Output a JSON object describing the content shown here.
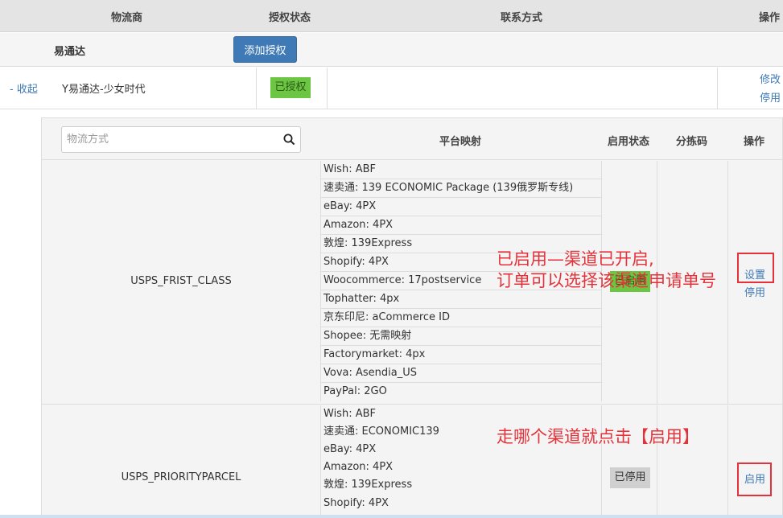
{
  "header": {
    "provider": "物流商",
    "auth_status": "授权状态",
    "contact": "联系方式",
    "operation": "操作"
  },
  "provider": {
    "name": "易通达",
    "add_auth_label": "添加授权"
  },
  "account": {
    "collapse_label": "- 收起",
    "name": "Y易通达-少女时代",
    "status": "已授权",
    "edit_label": "修改",
    "disable_label": "停用"
  },
  "channel_table": {
    "search_placeholder": "物流方式",
    "col_mapping": "平台映射",
    "col_status": "启用状态",
    "col_sort_code": "分拣码",
    "col_operation": "操作"
  },
  "channels": [
    {
      "name": "USPS_FRIST_CLASS",
      "status": "已启用",
      "op1": "设置",
      "op2": "停用",
      "mappings": [
        "Wish:  ABF",
        "速卖通:  139 ECONOMIC Package (139俄罗斯专线)",
        "eBay:  4PX",
        "Amazon:  4PX",
        "敦煌:  139Express",
        "Shopify:  4PX",
        "Woocommerce:  17postservice",
        "Tophatter:  4px",
        "京东印尼:  aCommerce ID",
        "Shopee:  无需映射",
        "Factorymarket:  4px",
        "Vova:  Asendia_US",
        "PayPal:  2GO"
      ]
    },
    {
      "name": "USPS_PRIORITYPARCEL",
      "status": "已停用",
      "op1": "启用",
      "mappings": [
        "Wish:  ABF",
        "速卖通:  ECONOMIC139",
        "eBay:  4PX",
        "Amazon:  4PX",
        "敦煌:  139Express",
        "Shopify:  4PX"
      ]
    }
  ],
  "annotations": {
    "note1_line1": "已启用—渠道已开启,",
    "note1_line2": "订单可以选择该渠道申请单号",
    "note2": "走哪个渠道就点击【启用】"
  },
  "colors": {
    "primary": "#3f7ab6",
    "enabled_green": "#6cc644",
    "disabled_grey": "#d0d0d0",
    "annotation_red": "#e5323a"
  }
}
